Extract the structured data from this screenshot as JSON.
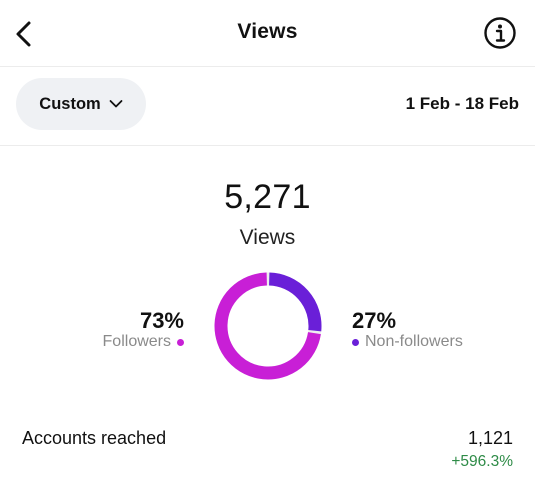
{
  "header": {
    "title": "Views"
  },
  "filter": {
    "label": "Custom",
    "date_range": "1 Feb - 18 Feb"
  },
  "summary": {
    "total_views": "5,271",
    "total_label": "Views"
  },
  "breakdown": {
    "followers": {
      "percent_label": "73%",
      "label": "Followers",
      "value": 73,
      "color": "#c81fd6"
    },
    "non_followers": {
      "percent_label": "27%",
      "label": "Non-followers",
      "value": 27,
      "color": "#6a1fd8"
    }
  },
  "metrics": [
    {
      "label": "Accounts reached",
      "value": "1,121",
      "change": "+596.3%",
      "change_color": "#2e8b47"
    }
  ],
  "icons": {
    "back": "chevron-left-icon",
    "info": "info-icon",
    "dropdown": "chevron-down-icon"
  }
}
